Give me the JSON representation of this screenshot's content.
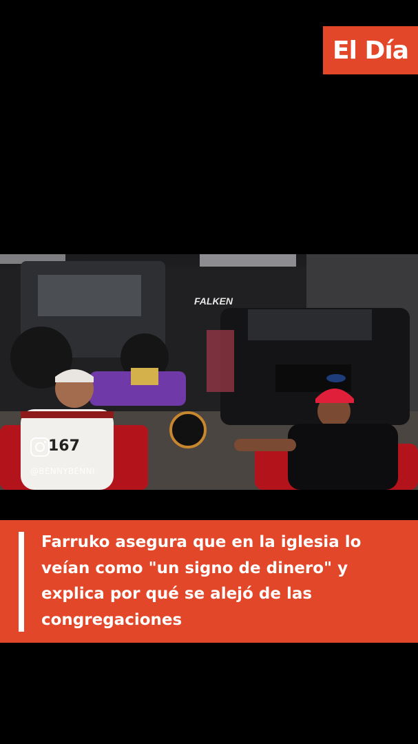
{
  "brand": {
    "logo_text": "El Día",
    "color": "#e2472a"
  },
  "video": {
    "watermark_icon": "instagram-icon",
    "watermark_handle": "@BENNYBENNI",
    "signage": [
      "FALKEN"
    ]
  },
  "caption": {
    "headline": "Farruko asegura que en la iglesia lo veían como \"un signo de dinero\" y explica por qué se alejó de las congregaciones"
  }
}
